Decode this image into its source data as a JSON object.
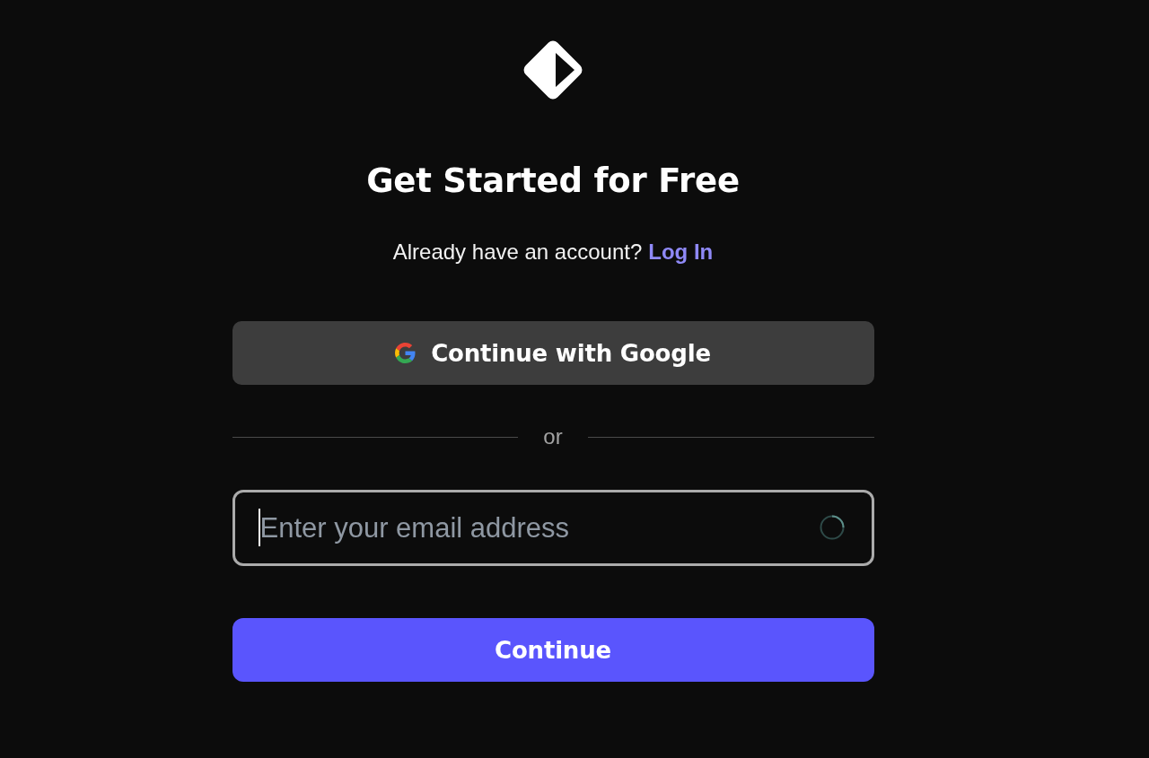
{
  "heading": "Get Started for Free",
  "login_prompt": {
    "text": "Already have an account?",
    "link": "Log In"
  },
  "google_button": {
    "label": "Continue with Google"
  },
  "divider": {
    "label": "or"
  },
  "email_field": {
    "placeholder": "Enter your email address",
    "focused": true,
    "loading": true
  },
  "submit_button": {
    "label": "Continue"
  }
}
